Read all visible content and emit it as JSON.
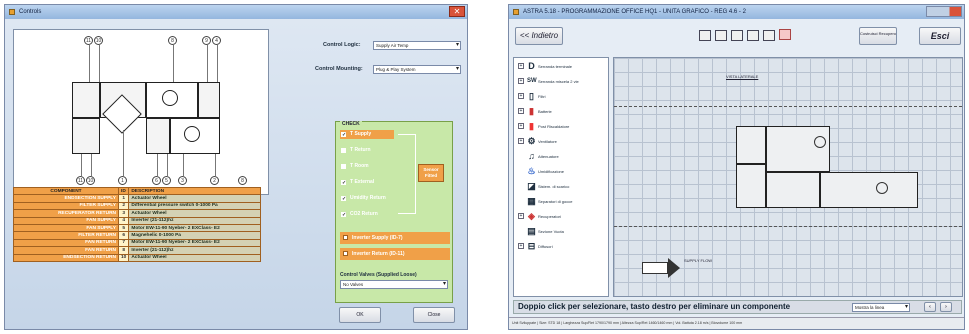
{
  "left_window": {
    "title": "Controls",
    "control_logic_label": "Control Logic:",
    "control_logic_value": "Supply Air Temp",
    "control_mounting_label": "Control Mounting:",
    "control_mounting_value": "Plug & Play System",
    "diagram_top_numbers": [
      "11",
      "10",
      "8",
      "9",
      "4"
    ],
    "diagram_bottom_numbers": [
      "11",
      "10",
      "1",
      "6",
      "5",
      "3",
      "2",
      "8"
    ],
    "component_table": {
      "headers": [
        "COMPONENT",
        "ID",
        "DESCRIPTION"
      ],
      "rows": [
        [
          "ENDSECTION SUPPLY",
          "1",
          "Actuator Wheel"
        ],
        [
          "FILTER SUPPLY",
          "2",
          "Differential pressure switch 0-1000 Pa"
        ],
        [
          "RECUPERATOR RETURN",
          "3",
          "Actuator Wheel"
        ],
        [
          "FAN SUPPLY",
          "4",
          "Inverter (21-112)hz"
        ],
        [
          "FAN SUPPLY",
          "5",
          "Motor EW-11-90 Nyeber- 2 EXClass- E2"
        ],
        [
          "FILTER RETURN",
          "6",
          "Magnehelic 0-1000 Pa"
        ],
        [
          "FAN RETURN",
          "7",
          "Motor EW-11-90 Nyeber- 2 EXClass- E2"
        ],
        [
          "FAN RETURN",
          "8",
          "Inverter (21-112)hz"
        ],
        [
          "ENDSECTION RETURN",
          "10",
          "Actuator Wheel"
        ]
      ]
    },
    "check_title": "CHECK",
    "checks": [
      {
        "label": "T Supply",
        "checked": true,
        "selected": true
      },
      {
        "label": "T Return",
        "checked": false,
        "selected": false
      },
      {
        "label": "T Room",
        "checked": false,
        "selected": false
      },
      {
        "label": "T External",
        "checked": true,
        "selected": false
      },
      {
        "label": "Umidity Return",
        "checked": true,
        "selected": false
      },
      {
        "label": "CO2 Return",
        "checked": true,
        "selected": false
      }
    ],
    "sensor_label": "Sensor Fitted",
    "inverters": [
      "Inverter Supply (ID-7)",
      "Inverter Return (ID-11)"
    ],
    "control_valves_label": "Control Valves (Supplied Loose)",
    "control_valves_value": "No Valves",
    "ok_label": "OK",
    "close_label": "Close"
  },
  "right_window": {
    "title": "ASTRA 5.18 - PROGRAMMAZIONE OFFICE HQ1 - UNITA GRAFICO - REG 4.6 - 2",
    "back_label": "<< Indietro",
    "custom_label": "Costruisci Recupero",
    "exit_label": "Esci",
    "tool_icons": [
      "save-icon",
      "grid-icon",
      "export-icon",
      "print-icon",
      "settings-icon",
      "notes-icon"
    ],
    "components": [
      {
        "glyph": "D",
        "label": "Serranda terminale"
      },
      {
        "glyph": "SW",
        "label": "Serranda miscela 2 vie"
      },
      {
        "glyph": "▯",
        "label": "Filtri"
      },
      {
        "glyph": "▮",
        "label": "Batterie"
      },
      {
        "glyph": "▮",
        "label": "Post Riscaldatore"
      },
      {
        "glyph": "⚙",
        "label": "Ventilatore"
      },
      {
        "glyph": "♫",
        "label": "Attenuatore"
      },
      {
        "glyph": "♨",
        "label": "Umidificazione"
      },
      {
        "glyph": "◪",
        "label": "Sistem. di scarico"
      },
      {
        "glyph": "▦",
        "label": "Separatori di gocce"
      },
      {
        "glyph": "◈",
        "label": "Recuperatori"
      },
      {
        "glyph": "▤",
        "label": "Sezione Vuota"
      },
      {
        "glyph": "⊟",
        "label": "Diffusori"
      }
    ],
    "canvas_title": "VISTA LATERALE",
    "supply_label": "SUPPLY FLOW",
    "status_text": "Doppio click per selezionare, tasto destro per eliminare un componente",
    "status_select": "Mostra la linea",
    "statusbar": "Unit Sviluppate | Size: STD 18 | Larghezza Sup/Ret 1790/1790 mm | Altezza Sup/Ret 1460/1460 mm | Vol. Battuta 2.18 m/s | Biovolume 100 mm"
  }
}
